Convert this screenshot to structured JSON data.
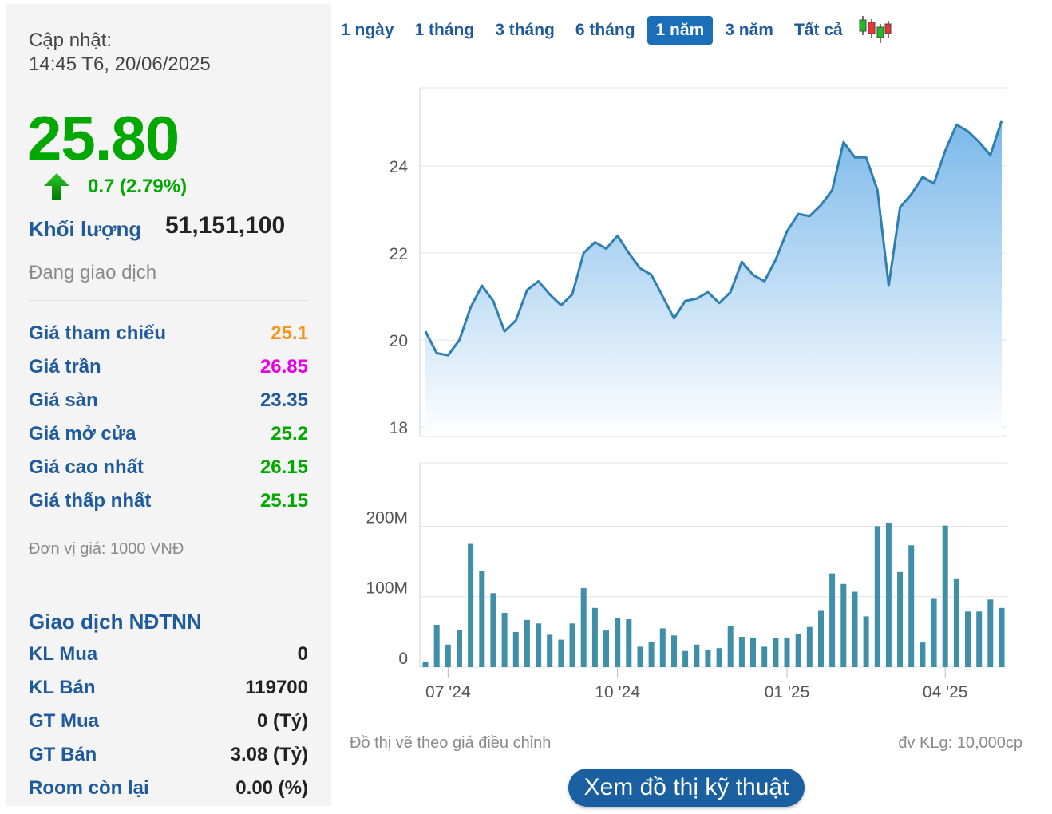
{
  "left": {
    "update_label": "Cập nhật:",
    "update_time": "14:45 T6, 20/06/2025",
    "price": "25.80",
    "change": "0.7 (2.79%)",
    "volume_label": "Khối lượng",
    "volume_value": "51,151,100",
    "status": "Đang giao dịch",
    "price_rows": [
      {
        "label": "Giá tham chiếu",
        "value": "25.1",
        "color": "#f7941d"
      },
      {
        "label": "Giá trần",
        "value": "26.85",
        "color": "#e600e6"
      },
      {
        "label": "Giá sàn",
        "value": "23.35",
        "color": "#1f5b9c"
      },
      {
        "label": "Giá mở cửa",
        "value": "25.2",
        "color": "#00a800"
      },
      {
        "label": "Giá cao nhất",
        "value": "26.15",
        "color": "#00a800"
      },
      {
        "label": "Giá thấp nhất",
        "value": "25.15",
        "color": "#00a800"
      }
    ],
    "unit_note": "Đơn vị giá: 1000 VNĐ",
    "foreign_title": "Giao dịch NĐTNN",
    "foreign_rows": [
      {
        "label": "KL Mua",
        "value": "0"
      },
      {
        "label": "KL Bán",
        "value": "119700"
      },
      {
        "label": "GT Mua",
        "value": "0 (Tỷ)"
      },
      {
        "label": "GT Bán",
        "value": "3.08 (Tỷ)"
      },
      {
        "label": "Room còn lại",
        "value": "0.00 (%)"
      }
    ]
  },
  "tabs": [
    "1 ngày",
    "1 tháng",
    "3 tháng",
    "6 tháng",
    "1 năm",
    "3 năm",
    "Tất cả"
  ],
  "active_tab": "1 năm",
  "icons": {
    "arrow": "up-arrow-icon",
    "candlestick": "candlestick-icon"
  },
  "colors": {
    "up": "#00a800",
    "line": "#2f7fb0",
    "area_top": "#7ab8ea",
    "bar": "#3f8fa8",
    "accent": "#1a6fb8"
  },
  "chart_data": {
    "type": "area",
    "x_tick_labels": [
      "07 '24",
      "10 '24",
      "01 '25",
      "04 '25"
    ],
    "x_tick_positions": [
      2,
      17,
      32,
      46
    ],
    "price": {
      "yticks": [
        18,
        20,
        22,
        24
      ],
      "ylim": [
        17.8,
        25.8
      ],
      "values": [
        20.2,
        19.7,
        19.65,
        20.0,
        20.75,
        21.25,
        20.9,
        20.2,
        20.45,
        21.15,
        21.35,
        21.05,
        20.8,
        21.05,
        22.0,
        22.25,
        22.1,
        22.4,
        22.0,
        21.65,
        21.5,
        21.0,
        20.5,
        20.9,
        20.95,
        21.1,
        20.85,
        21.1,
        21.8,
        21.5,
        21.35,
        21.85,
        22.5,
        22.9,
        22.85,
        23.1,
        23.45,
        24.55,
        24.2,
        24.2,
        23.45,
        21.25,
        23.05,
        23.35,
        23.75,
        23.6,
        24.35,
        24.95,
        24.8,
        24.55,
        24.25,
        25.05
      ]
    },
    "volume": {
      "yticks": [
        0,
        100,
        200
      ],
      "ytick_labels": [
        "0",
        "100M",
        "200M"
      ],
      "ylim": [
        0,
        290
      ],
      "values": [
        8,
        60,
        32,
        53,
        175,
        137,
        105,
        77,
        50,
        67,
        62,
        46,
        39,
        62,
        112,
        84,
        52,
        70,
        68,
        29,
        36,
        55,
        45,
        23,
        32,
        25,
        27,
        58,
        43,
        42,
        29,
        42,
        42,
        47,
        57,
        81,
        133,
        118,
        107,
        72,
        200,
        205,
        135,
        173,
        35,
        98,
        201,
        126,
        79,
        79,
        96,
        84
      ]
    },
    "notes": {
      "left": "Đồ thị vẽ theo giá điều chỉnh",
      "right": "đv KLg: 10,000cp"
    }
  },
  "button_label": "Xem đồ thị kỹ thuật"
}
